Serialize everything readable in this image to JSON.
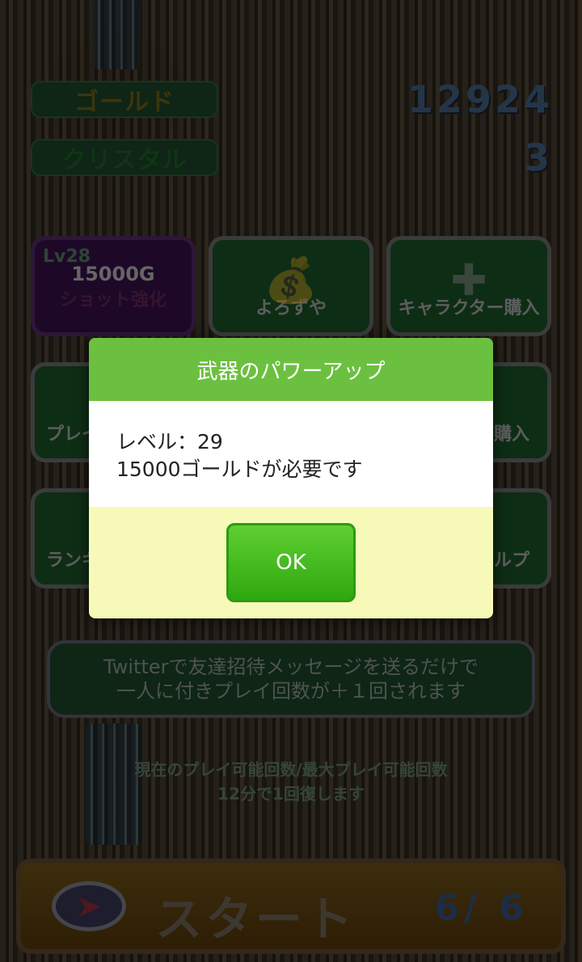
{
  "header": {
    "gold_label": "ゴールド",
    "gold_value": "12924",
    "crystal_label": "クリスタル",
    "crystal_value": "3"
  },
  "menu": {
    "shot": {
      "level": "Lv28",
      "price": "15000G",
      "label": "ショット強化"
    },
    "shop": {
      "label": "よろずや"
    },
    "character": {
      "label": "キャラクター購入"
    },
    "row2_left": {
      "label": "プレイ"
    },
    "row2_right": {
      "label": "購入"
    },
    "row3_left": {
      "label": "ランキ"
    },
    "row3_right": {
      "label": "ルプ"
    }
  },
  "invite": {
    "line1": "Twitterで友達招待メッセージを送るだけで",
    "line2": "一人に付きプレイ回数が＋１回されます"
  },
  "play_info": {
    "line1": "現在のプレイ可能回数/最大プレイ可能回数",
    "line2": "12分で1回復します"
  },
  "start": {
    "label": "スタート",
    "count": "6/ 6"
  },
  "dialog": {
    "title": "武器のパワーアップ",
    "line1": "レベル：29",
    "line2": "15000ゴールドが必要です",
    "ok_label": "OK"
  }
}
